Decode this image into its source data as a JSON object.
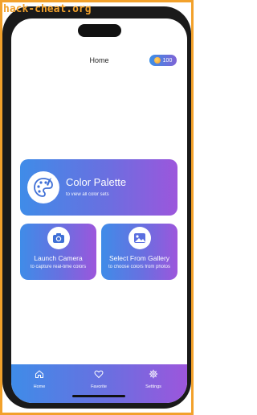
{
  "watermark": "hack-cheat.org",
  "header": {
    "title": "Home",
    "coins": "100"
  },
  "cards": {
    "palette": {
      "title": "Color Palette",
      "subtitle": "to view all color sets"
    },
    "camera": {
      "title": "Launch Camera",
      "subtitle": "to capture real-time colors"
    },
    "gallery": {
      "title": "Select From Gallery",
      "subtitle": "to choose colors from photos"
    }
  },
  "nav": {
    "home": "Home",
    "favorite": "Favorite",
    "settings": "Settings"
  },
  "colors": {
    "frame": "#f2a12b",
    "gradient_start": "#3f8ce8",
    "gradient_end": "#9c56dc"
  },
  "icons": {
    "coin": "coin-icon",
    "palette": "palette-icon",
    "camera": "camera-icon",
    "gallery": "image-icon",
    "home": "home-icon",
    "favorite": "heart-icon",
    "settings": "gear-icon"
  }
}
